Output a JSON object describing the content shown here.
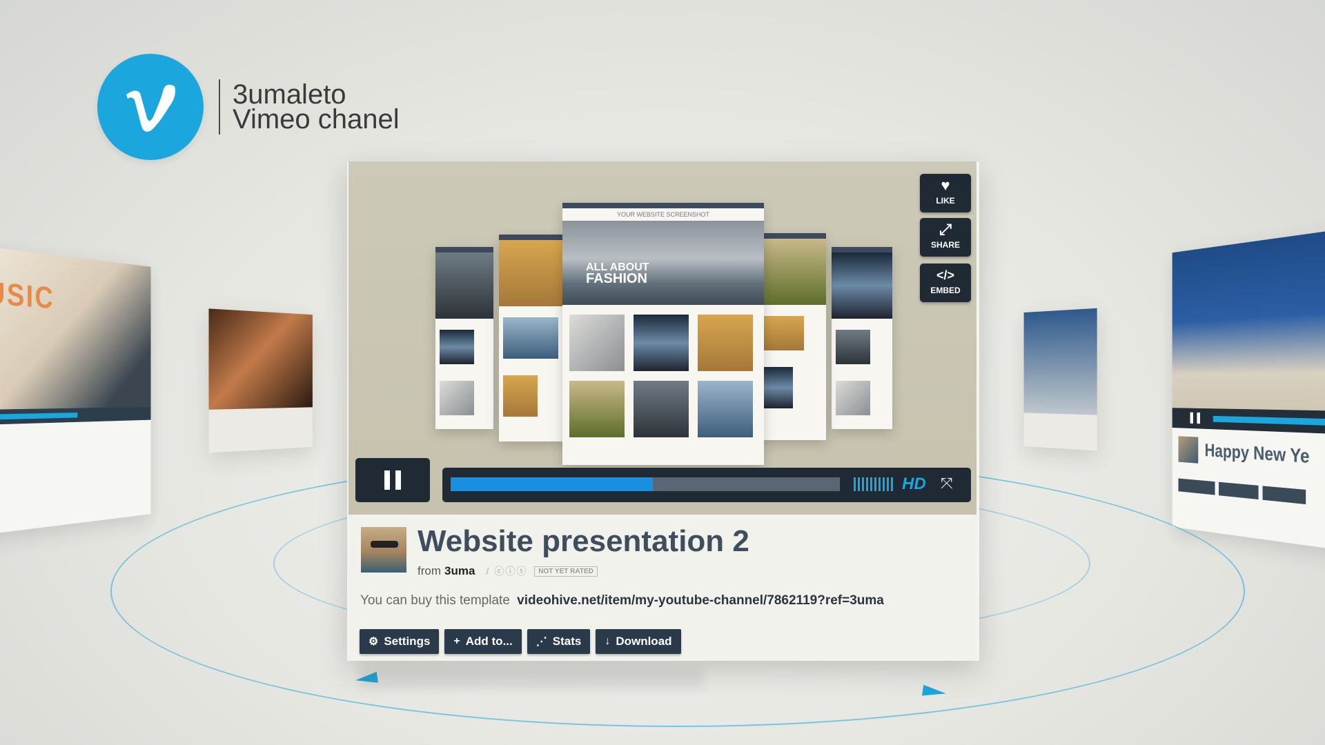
{
  "brand": {
    "logo_letter": "v",
    "line1": "3umaleto",
    "line2": "Vimeo chanel",
    "color": "#1ba7dd"
  },
  "player": {
    "mock": {
      "header": "YOUR WEBSITE SCREENSHOT",
      "hero_text_1": "ALL ABOUT",
      "hero_text_2": "FASHION"
    },
    "side_buttons": [
      {
        "label": "LIKE",
        "icon": "heart-icon"
      },
      {
        "label": "SHARE",
        "icon": "share-icon"
      },
      {
        "label": "EMBED",
        "icon": "embed-icon"
      }
    ],
    "progress": 0.52,
    "hd_label": "HD",
    "accent": "#1a8fe0"
  },
  "video": {
    "title": "Website presentation 2",
    "from_label": "from",
    "author": "3uma",
    "rating": "NOT YET RATED",
    "buy_text": "You can buy this template",
    "buy_link": "videohive.net/item/my-youtube-channel/7862119?ref=3uma"
  },
  "actions": [
    {
      "label": "Settings",
      "icon": "gear-icon"
    },
    {
      "label": "Add to...",
      "icon": "plus-icon"
    },
    {
      "label": "Stats",
      "icon": "stats-icon"
    },
    {
      "label": "Download",
      "icon": "download-icon"
    }
  ],
  "side_cards": {
    "left_title": "USIC",
    "right_title": "Happy New Ye"
  }
}
